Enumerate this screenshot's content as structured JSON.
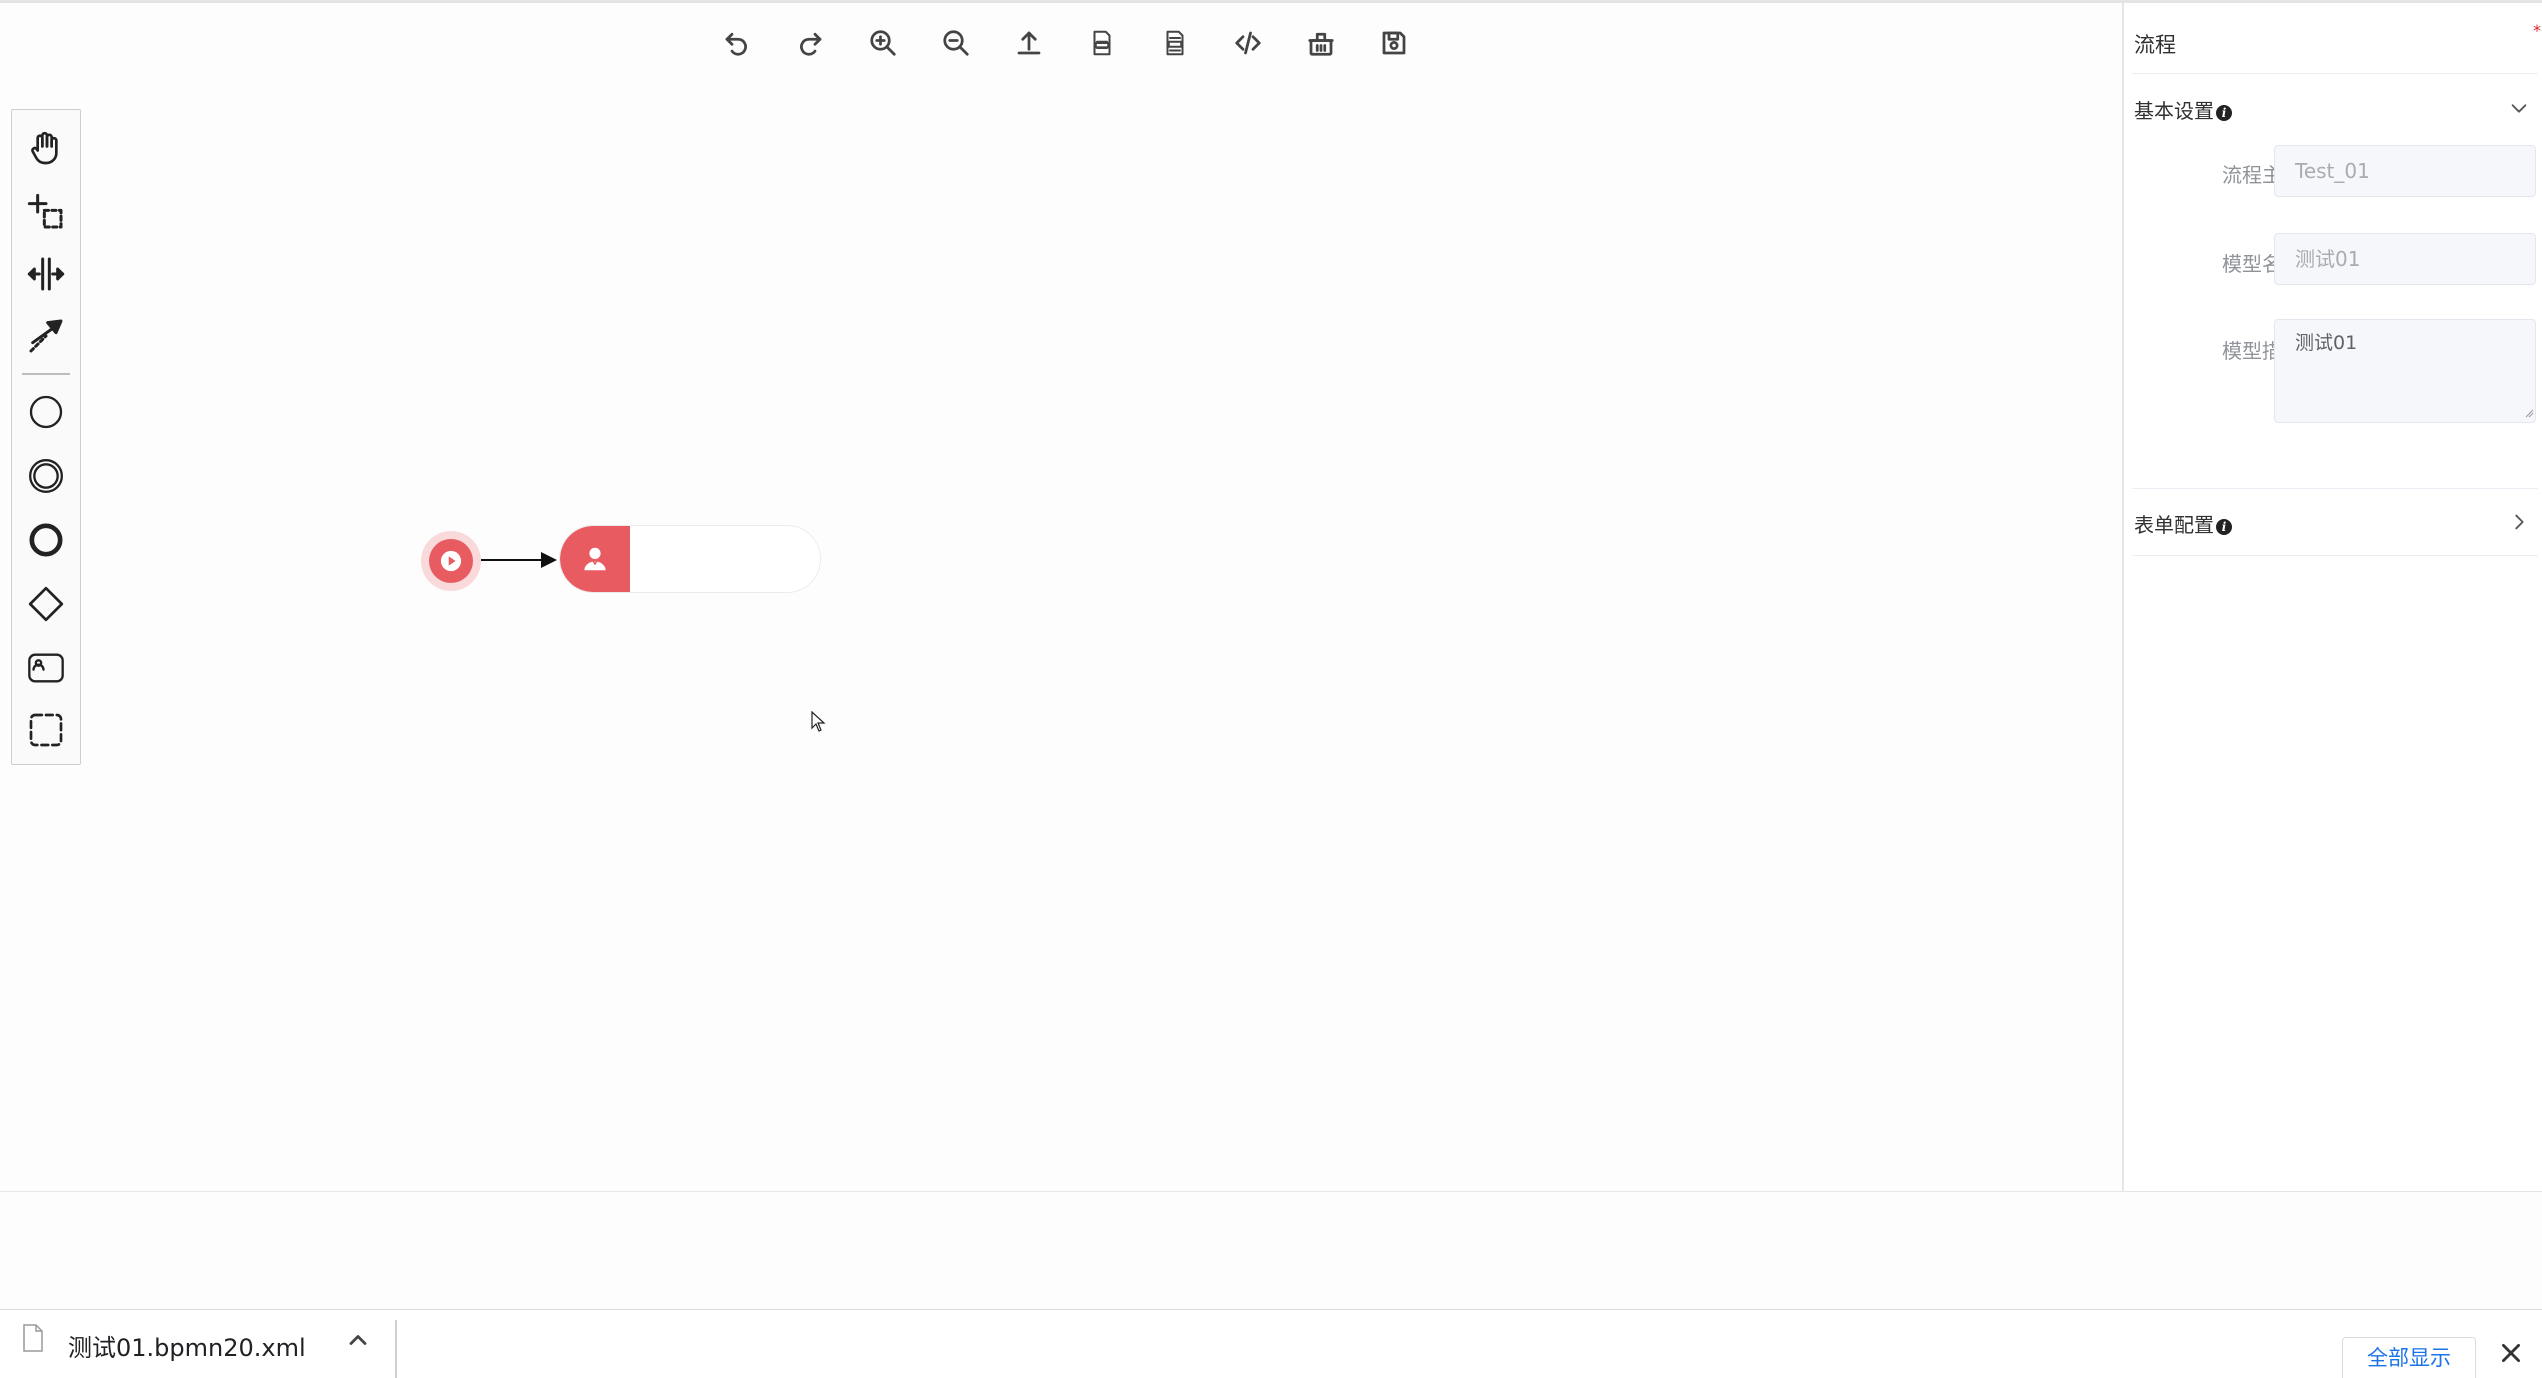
{
  "toolbar": {
    "buttons": [
      {
        "icon": "undo-icon"
      },
      {
        "icon": "redo-icon"
      },
      {
        "icon": "zoom-in-icon"
      },
      {
        "icon": "zoom-out-icon"
      },
      {
        "icon": "upload-icon"
      },
      {
        "icon": "download-xml-icon"
      },
      {
        "icon": "download-svg-icon"
      },
      {
        "icon": "code-icon"
      },
      {
        "icon": "clear-basket-icon"
      },
      {
        "icon": "save-icon"
      }
    ]
  },
  "palette": {
    "tools": [
      {
        "icon": "hand-tool-icon"
      },
      {
        "icon": "lasso-tool-icon"
      },
      {
        "icon": "space-tool-icon"
      },
      {
        "icon": "global-connect-icon"
      },
      {
        "icon": "start-event-icon"
      },
      {
        "icon": "intermediate-event-icon"
      },
      {
        "icon": "end-event-icon"
      },
      {
        "icon": "gateway-icon"
      },
      {
        "icon": "user-task-icon"
      },
      {
        "icon": "group-icon"
      }
    ]
  },
  "diagram": {
    "start_event_color": "#e85b61",
    "user_task_color": "#e85b61",
    "user_task_label": ""
  },
  "panel": {
    "title": "流程",
    "basic_section": {
      "title": "基本设置",
      "info": "i",
      "fields": {
        "key_label": "流程主键",
        "key_value": "Test_01",
        "name_label": "模型名称",
        "name_value": "测试01",
        "desc_label": "模型描述",
        "desc_value": "测试01"
      }
    },
    "form_section": {
      "title": "表单配置",
      "info": "i"
    }
  },
  "downloads": {
    "file_name": "测试01.bpmn20.xml",
    "show_all_label": "全部显示",
    "link_color": "#1a73e8"
  }
}
